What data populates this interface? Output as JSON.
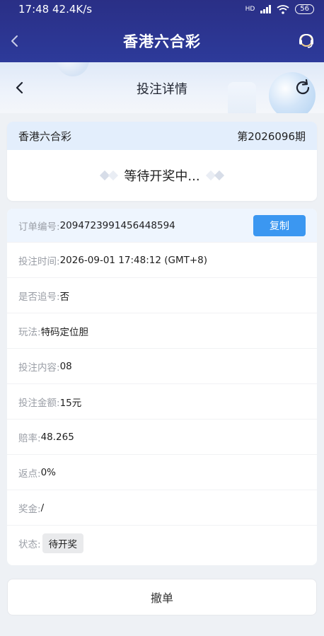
{
  "status_bar": {
    "time_speed": "17:48 42.4K/s",
    "network": "HD",
    "battery": "56"
  },
  "app_header": {
    "title": "香港六合彩"
  },
  "sub_header": {
    "title": "投注详情"
  },
  "lottery": {
    "name": "香港六合彩",
    "period": "第2026096期",
    "waiting_text": "等待开奖中..."
  },
  "order": {
    "rows": [
      {
        "label": "订单编号: ",
        "value": "2094723991456448594"
      },
      {
        "label": "投注时间: ",
        "value": "2026-09-01 17:48:12 (GMT+8)"
      },
      {
        "label": "是否追号: ",
        "value": "否"
      },
      {
        "label": "玩法: ",
        "value": "特码定位胆"
      },
      {
        "label": "投注内容: ",
        "value": "08"
      },
      {
        "label": "投注金额: ",
        "value": "15元"
      },
      {
        "label": "赔率: ",
        "value": "48.265"
      },
      {
        "label": "返点: ",
        "value": "0%"
      },
      {
        "label": "奖金: ",
        "value": "/"
      },
      {
        "label": "状态: ",
        "value": "待开奖"
      }
    ],
    "copy_label": "复制"
  },
  "cancel_label": "撤单",
  "colors": {
    "header_bg": "#2a2f86",
    "accent": "#3b97f1",
    "card_header_bg": "#e3eefc"
  },
  "icons": {
    "back": "chevron-left-icon",
    "customer_service": "headset-icon",
    "refresh": "refresh-icon",
    "diamond": "diamond-icon"
  }
}
